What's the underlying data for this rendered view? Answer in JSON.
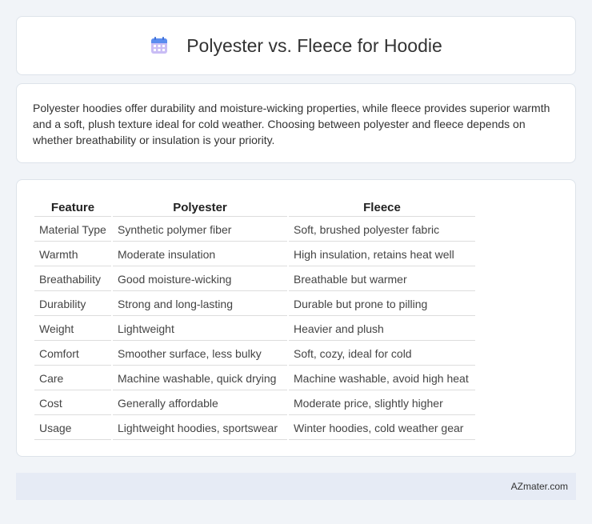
{
  "header": {
    "title": "Polyester vs. Fleece for Hoodie",
    "icon": "calendar-icon"
  },
  "intro": {
    "text": "Polyester hoodies offer durability and moisture-wicking properties, while fleece provides superior warmth and a soft, plush texture ideal for cold weather. Choosing between polyester and fleece depends on whether breathability or insulation is your priority."
  },
  "table": {
    "headers": [
      "Feature",
      "Polyester",
      "Fleece"
    ],
    "rows": [
      [
        "Material Type",
        "Synthetic polymer fiber",
        "Soft, brushed polyester fabric"
      ],
      [
        "Warmth",
        "Moderate insulation",
        "High insulation, retains heat well"
      ],
      [
        "Breathability",
        "Good moisture-wicking",
        "Breathable but warmer"
      ],
      [
        "Durability",
        "Strong and long-lasting",
        "Durable but prone to pilling"
      ],
      [
        "Weight",
        "Lightweight",
        "Heavier and plush"
      ],
      [
        "Comfort",
        "Smoother surface, less bulky",
        "Soft, cozy, ideal for cold"
      ],
      [
        "Care",
        "Machine washable, quick drying",
        "Machine washable, avoid high heat"
      ],
      [
        "Cost",
        "Generally affordable",
        "Moderate price, slightly higher"
      ],
      [
        "Usage",
        "Lightweight hoodies, sportswear",
        "Winter hoodies, cold weather gear"
      ]
    ]
  },
  "footer": {
    "site": "AZmater.com"
  },
  "colors": {
    "background": "#f1f4f8",
    "card": "#ffffff",
    "footer_bg": "#e6ebf5",
    "icon_blue": "#5b8def",
    "icon_purple": "#b9a6f2"
  }
}
